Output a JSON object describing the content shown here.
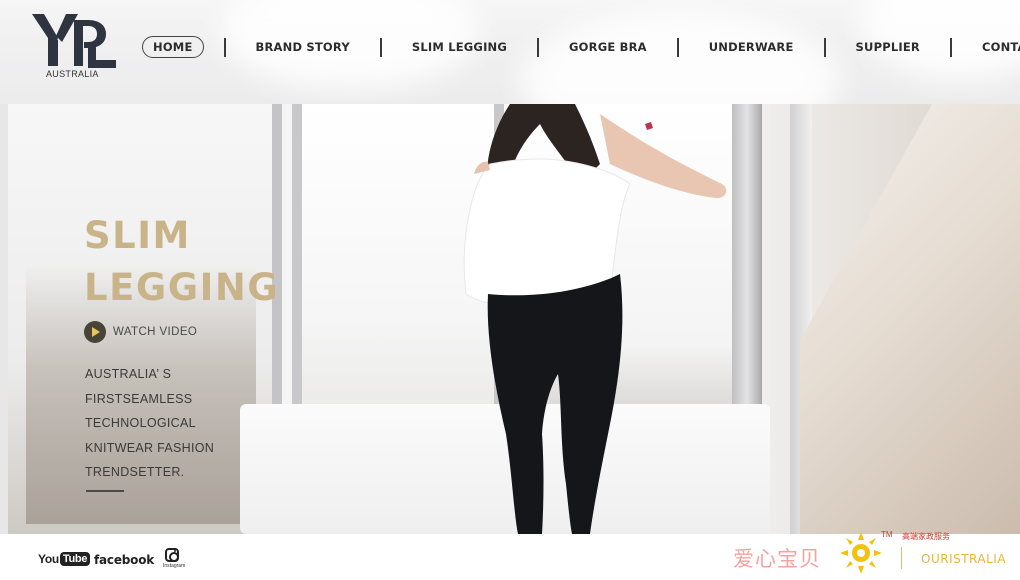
{
  "brand": {
    "logo_mark": "YPL",
    "logo_sub": "AUSTRALIA"
  },
  "nav": {
    "items": [
      {
        "label": "HOME",
        "active": true
      },
      {
        "label": "BRAND STORY"
      },
      {
        "label": "SLIM LEGGING"
      },
      {
        "label": "GORGE BRA"
      },
      {
        "label": "UNDERWARE"
      },
      {
        "label": "SUPPLIER"
      },
      {
        "label": "CONTACT US"
      }
    ]
  },
  "hero": {
    "title_line1": "SLIM",
    "title_line2": "LEGGING",
    "watch_video": "WATCH VIDEO",
    "tagline": [
      "AUSTRALIA’ S",
      "FIRSTSEAMLESS",
      "TECHNOLOGICAL",
      "KNITWEAR FASHION",
      "TRENDSETTER."
    ],
    "title_color": "#c9b48a"
  },
  "footer": {
    "youtube_you": "You",
    "youtube_tube": "Tube",
    "facebook": "facebook",
    "instagram": "Instagram"
  },
  "watermark": {
    "cn_name": "爱心宝贝",
    "tm": "TM",
    "small_text": "高端家政服务",
    "brand_text": "OURISTRALIA"
  },
  "icons": [
    "logo-icon",
    "play-icon",
    "youtube-icon",
    "facebook-icon",
    "instagram-icon",
    "sun-logo-icon"
  ]
}
